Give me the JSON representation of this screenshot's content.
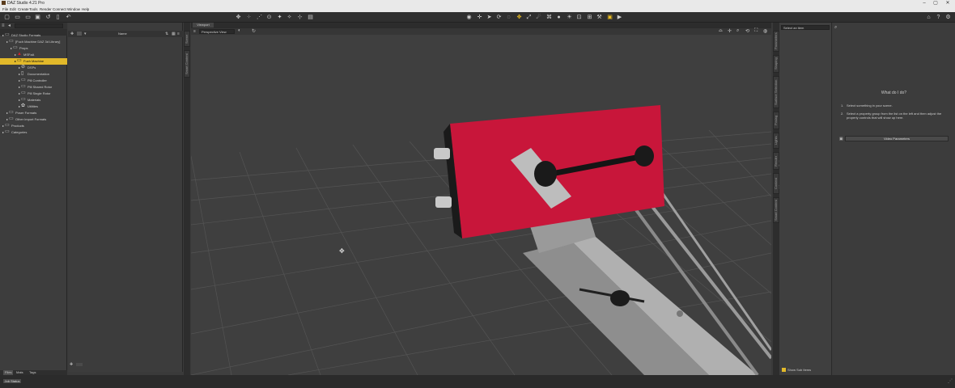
{
  "app": {
    "title": "DAZ Studio 4.21 Pro"
  },
  "menu": [
    "File",
    "Edit",
    "Create",
    "Tools",
    "Render",
    "Connect",
    "Window",
    "Help"
  ],
  "scene": {
    "items": [
      {
        "label": "DAZ Studio Formats",
        "indent": 0,
        "icon": "folder-icon"
      },
      {
        "label": "[Fuch Machine DAZ 3d Library]",
        "indent": 1,
        "icon": "folder-icon"
      },
      {
        "label": "Props",
        "indent": 2,
        "icon": "folder-icon"
      },
      {
        "label": "MSFaA",
        "indent": 3,
        "icon": "figure-icon"
      },
      {
        "label": "Fuch Machine",
        "indent": 3,
        "icon": "folder-icon",
        "selected": true
      },
      {
        "label": "DSPs",
        "indent": 4,
        "icon": "no-icon"
      },
      {
        "label": "Documentation",
        "indent": 4,
        "icon": "doc-icon"
      },
      {
        "label": "Pill Controller",
        "indent": 4,
        "icon": "folder-icon"
      },
      {
        "label": "Pill Shared Rotor",
        "indent": 4,
        "icon": "folder-icon"
      },
      {
        "label": "Pill Single Rotor",
        "indent": 4,
        "icon": "folder-icon"
      },
      {
        "label": "Materials",
        "indent": 4,
        "icon": "folder-icon"
      },
      {
        "label": "Utilities",
        "indent": 4,
        "icon": "gear-icon"
      },
      {
        "label": "Poser Formats",
        "indent": 1,
        "icon": "folder-icon"
      },
      {
        "label": "Other Import Formats",
        "indent": 1,
        "icon": "folder-icon"
      },
      {
        "label": "Products",
        "indent": 0,
        "icon": "folder-icon"
      },
      {
        "label": "Categories",
        "indent": 0,
        "icon": "folder-icon"
      }
    ]
  },
  "content": {
    "sort_label": "Name"
  },
  "left_tabs": [
    "Scene",
    "Smart Content"
  ],
  "bottom_tabs": [
    "Files",
    "Mats",
    "Tags"
  ],
  "viewport": {
    "tab_label": "Viewport",
    "view_select": "Perspective View"
  },
  "right_vtabs": [
    "Parameters",
    "Shaping",
    "Surface Selection",
    "Posing",
    "Lights",
    "Render Settings",
    "Content Library",
    "Smart Content"
  ],
  "parameters": {
    "select_label": "Select an item",
    "heading": "What do I do?",
    "step1_num": "1.",
    "step1": "Select something in your scene.",
    "step2_num": "2.",
    "step2": "Select a property group from the list on the left and then adjust the property controls that will show up here.",
    "video_button": "Video Parameters",
    "show_sub_items": "Show Sub Items"
  },
  "status": {
    "left": "Job Status"
  },
  "colors": {
    "selection": "#e2b92a",
    "panel": "#3c3c3c",
    "toolbar": "#2f2f2f",
    "machine_red": "#c8163a",
    "grid_bg": "#3f3f3f"
  }
}
